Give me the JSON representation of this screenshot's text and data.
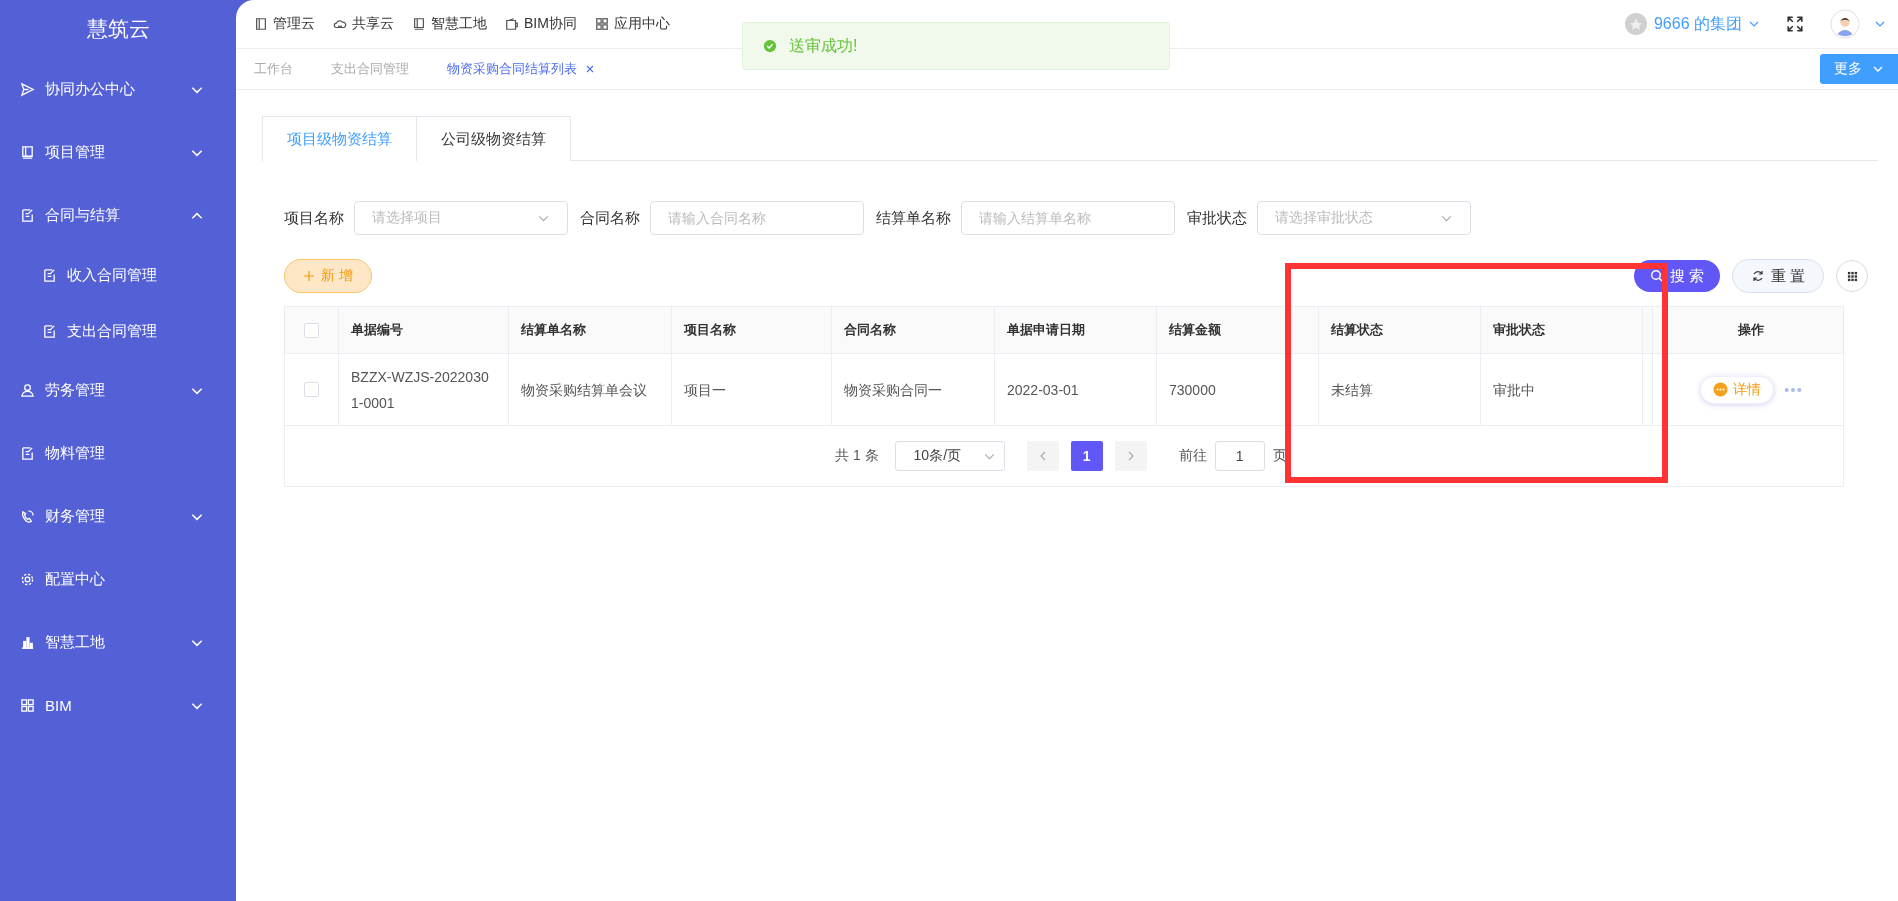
{
  "brand": "慧筑云",
  "sidebar": {
    "items": [
      {
        "label": "协同办公中心",
        "expanded": false
      },
      {
        "label": "项目管理",
        "expanded": false
      },
      {
        "label": "合同与结算",
        "expanded": true,
        "children": [
          {
            "label": "收入合同管理"
          },
          {
            "label": "支出合同管理"
          }
        ]
      },
      {
        "label": "劳务管理",
        "expanded": false
      },
      {
        "label": "物料管理"
      },
      {
        "label": "财务管理",
        "expanded": false
      },
      {
        "label": "配置中心"
      },
      {
        "label": "智慧工地",
        "expanded": false
      },
      {
        "label": "BIM",
        "expanded": false
      }
    ]
  },
  "top_nav": [
    {
      "label": "管理云"
    },
    {
      "label": "共享云"
    },
    {
      "label": "智慧工地"
    },
    {
      "label": "BIM协同"
    },
    {
      "label": "应用中心"
    }
  ],
  "org": "9666 的集团",
  "page_tabs": [
    {
      "label": "工作台",
      "selected": false,
      "closable": false
    },
    {
      "label": "支出合同管理",
      "selected": false,
      "closable": false
    },
    {
      "label": "物资采购合同结算列表",
      "selected": true,
      "closable": true
    }
  ],
  "more_button": "更多",
  "toast": {
    "message": "送审成功!"
  },
  "tabs": [
    {
      "label": "项目级物资结算",
      "selected": true
    },
    {
      "label": "公司级物资结算",
      "selected": false
    }
  ],
  "filters": [
    {
      "label": "项目名称",
      "placeholder": "请选择项目",
      "kind": "select"
    },
    {
      "label": "合同名称",
      "placeholder": "请输入合同名称",
      "kind": "input"
    },
    {
      "label": "结算单名称",
      "placeholder": "请输入结算单名称",
      "kind": "input"
    },
    {
      "label": "审批状态",
      "placeholder": "请选择审批状态",
      "kind": "select"
    }
  ],
  "add_button": "新 增",
  "search_button": "搜 索",
  "reset_button": "重 置",
  "table": {
    "header_checked": false,
    "columns": [
      "单据编号",
      "结算单名称",
      "项目名称",
      "合同名称",
      "单据申请日期",
      "结算金额",
      "结算状态",
      "审批状态",
      "操作"
    ],
    "rows": [
      {
        "checked": false,
        "cells": [
          "BZZX-WZJS-20220301-0001",
          "物资采购结算单会议",
          "项目一",
          "物资采购合同一",
          "2022-03-01",
          "730000",
          "未结算",
          "审批中"
        ],
        "action": "详情"
      }
    ]
  },
  "pagination": {
    "total": "共 1 条",
    "page_size": "10条/页",
    "pages": [
      {
        "label": "1",
        "selected": true
      }
    ],
    "goto_label": "前往",
    "goto_value": "1",
    "goto_suffix": "页"
  }
}
